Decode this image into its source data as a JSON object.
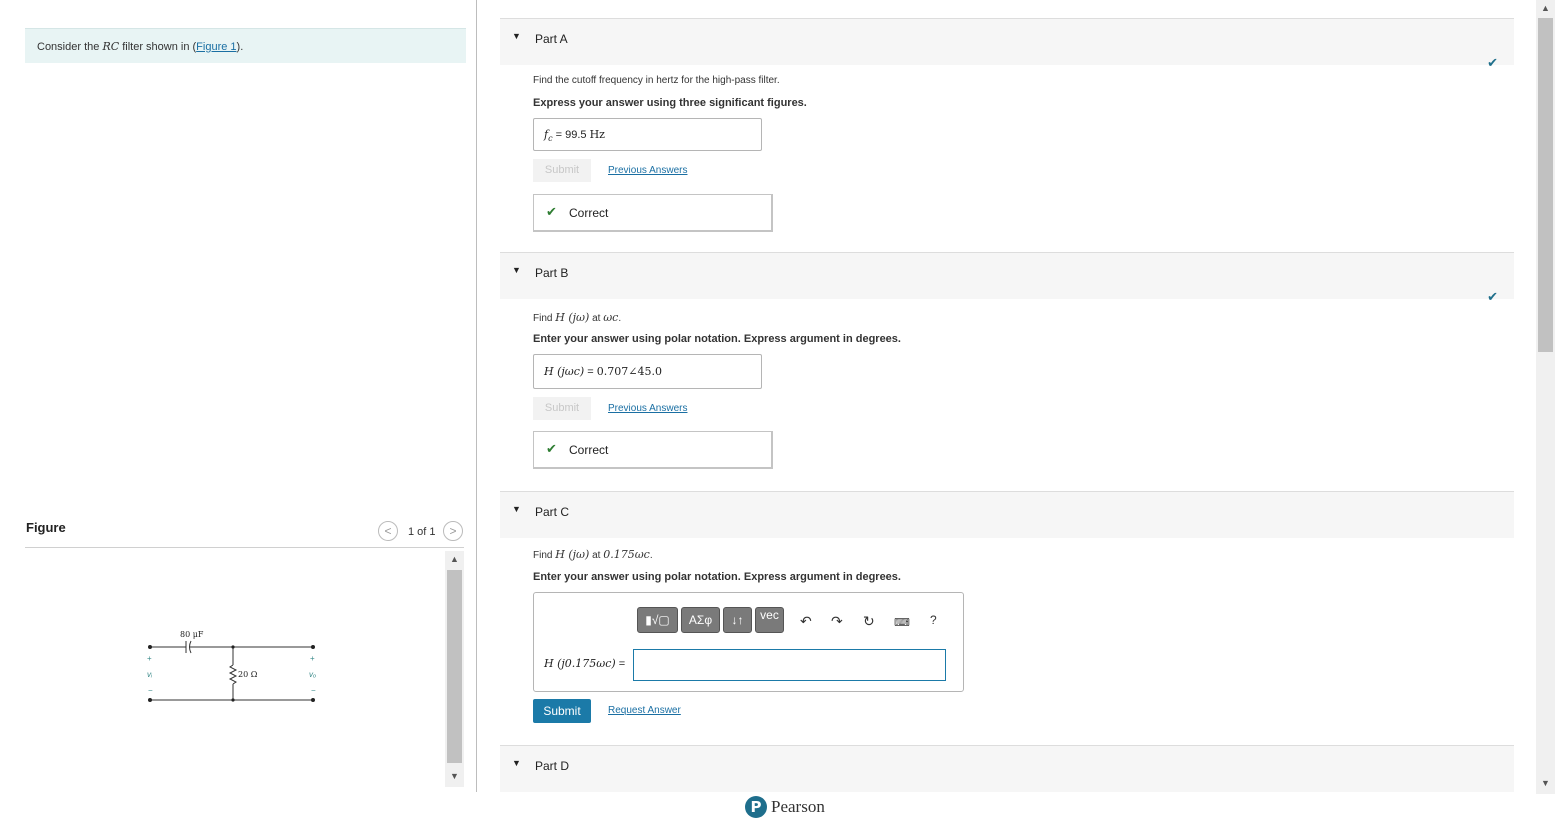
{
  "problem": {
    "prefix": "Consider the ",
    "rc": "RC",
    "middle": " filter shown in (",
    "figure_link": "Figure 1",
    "suffix": ")."
  },
  "figure": {
    "label": "Figure",
    "counter": "1 of 1",
    "capacitor_label": "80 μF",
    "resistor_label": "20 Ω",
    "input_label": "vᵢ",
    "output_label": "vₒ",
    "plus": "+",
    "minus": "−"
  },
  "parts": [
    {
      "title": "Part A",
      "question": "Find the cutoff frequency in hertz for the high-pass filter.",
      "instruction": "Express your answer using three significant figures.",
      "answer_lhs": "f",
      "answer_sub": "c",
      "answer_eq": " = ",
      "answer_value": "99.5",
      "answer_unit": "Hz",
      "submit_label": "Submit",
      "previous_label": "Previous Answers",
      "feedback": "Correct",
      "completed": true
    },
    {
      "title": "Part B",
      "question_prefix": "Find ",
      "question_expr": "H (jω)",
      "question_mid": " at ",
      "question_at": "ωc",
      "question_suffix": ".",
      "instruction": "Enter your answer using polar notation. Express argument in degrees.",
      "answer_lhs": "H (jωc)",
      "answer_eq": " = ",
      "answer_value": "0.707∠45.0",
      "submit_label": "Submit",
      "previous_label": "Previous Answers",
      "feedback": "Correct",
      "completed": true
    },
    {
      "title": "Part C",
      "question_prefix": "Find ",
      "question_expr": "H (jω)",
      "question_mid": " at ",
      "question_at": "0.175ωc",
      "question_suffix": ".",
      "instruction": "Enter your answer using polar notation. Express argument in degrees.",
      "answer_lhs": "H (j0.175ωc)",
      "answer_eq": " = ",
      "answer_value": "",
      "submit_label": "Submit",
      "request_label": "Request Answer",
      "toolbar": {
        "templates_label": "▮√▢",
        "greek_label": "ΑΣφ",
        "arrows_label": "↓↑",
        "vec_label": "vec",
        "help_label": "?"
      }
    },
    {
      "title": "Part D"
    }
  ],
  "footer": {
    "brand": "Pearson",
    "logo_letter": "P"
  },
  "colors": {
    "accent": "#1b7aa8",
    "correct_green": "#2e7d32",
    "header_bg": "#f6f6f6",
    "problem_bg": "#e8f4f4"
  }
}
